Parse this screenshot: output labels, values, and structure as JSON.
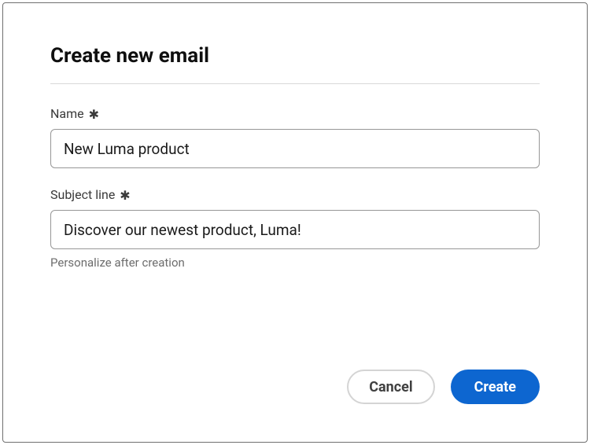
{
  "dialog": {
    "title": "Create new email",
    "fields": {
      "name": {
        "label": "Name",
        "required_mark": "✱",
        "value": "New Luma product"
      },
      "subject": {
        "label": "Subject line",
        "required_mark": "✱",
        "value": "Discover our newest product, Luma!",
        "helper": "Personalize after creation"
      }
    },
    "actions": {
      "cancel": "Cancel",
      "create": "Create"
    }
  }
}
